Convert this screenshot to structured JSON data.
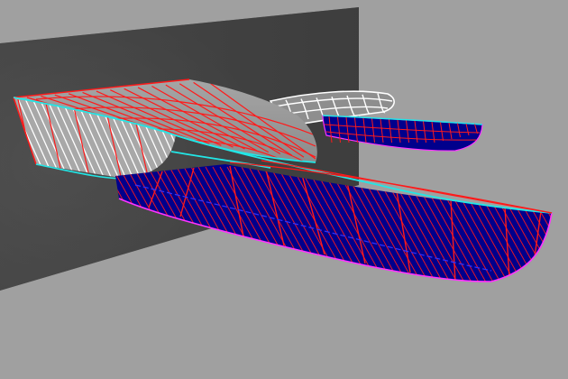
{
  "scene": {
    "background_color": "#a0a0a0",
    "wall_color": "#474747",
    "top_surface_color": "#9a9a9a",
    "section_side_color": "#a8a8a8",
    "lower_surface_color": "#00008c",
    "rib_color": "#ff1a1a",
    "edge_color": "#22e6e6",
    "trailing_edge_color": "#ff33ff",
    "white_grid_color": "#ffffff",
    "selected_line_color": "#3333ff"
  }
}
